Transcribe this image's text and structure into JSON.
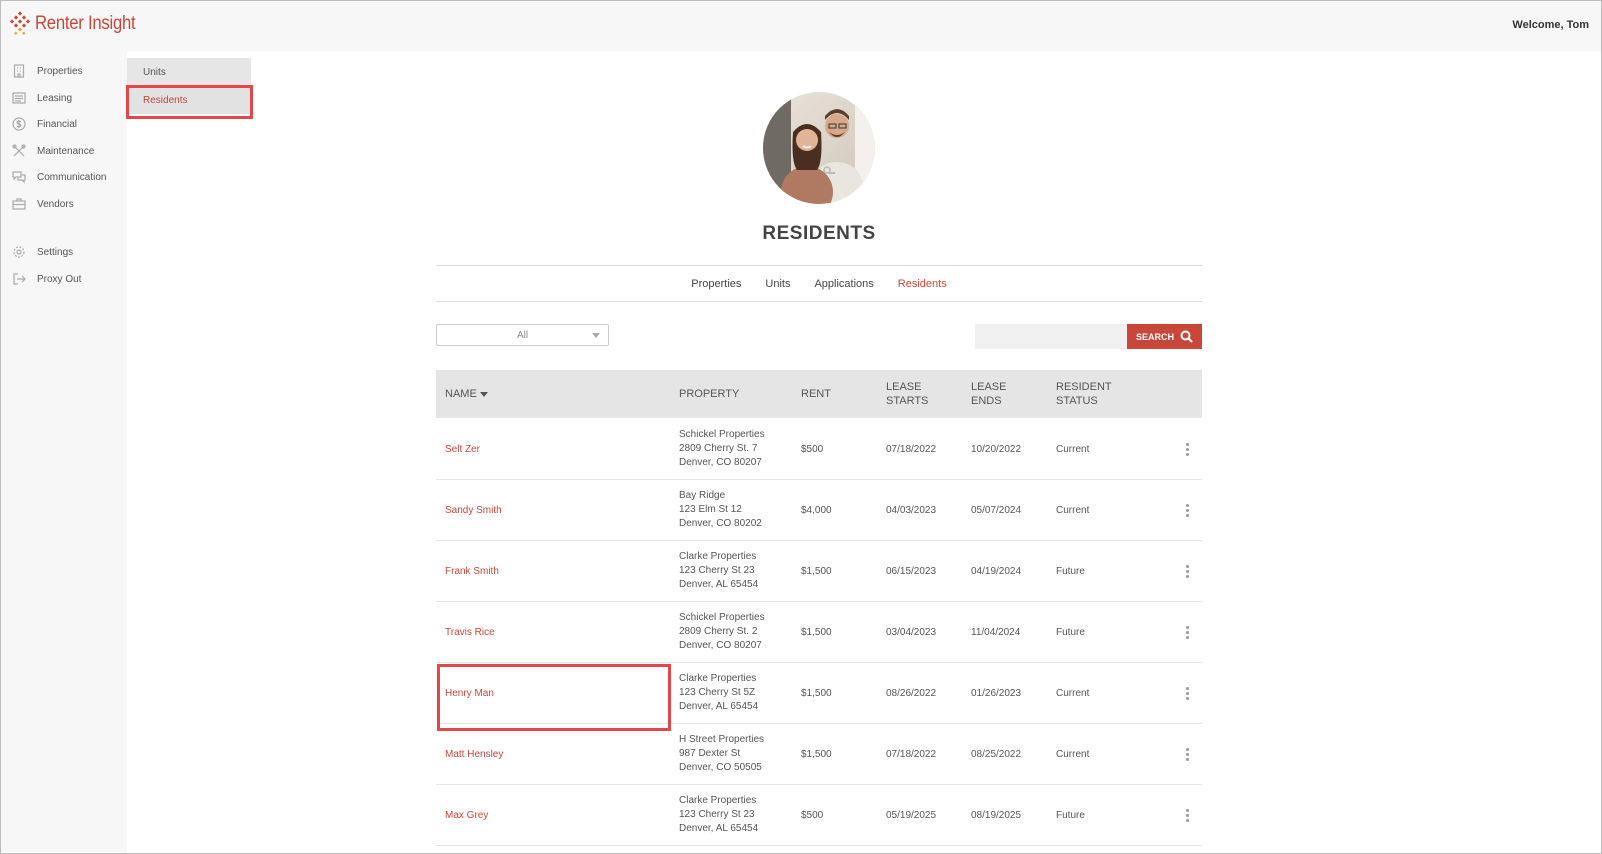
{
  "app": {
    "logo_text": "Renter Insight",
    "welcome": "Welcome, Tom"
  },
  "sidebar": {
    "items": [
      {
        "label": "Properties",
        "icon": "building-icon"
      },
      {
        "label": "Leasing",
        "icon": "list-icon"
      },
      {
        "label": "Financial",
        "icon": "dollar-icon"
      },
      {
        "label": "Maintenance",
        "icon": "tools-icon"
      },
      {
        "label": "Communication",
        "icon": "chat-icon"
      },
      {
        "label": "Vendors",
        "icon": "briefcase-icon"
      },
      {
        "label": "Settings",
        "icon": "gear-icon"
      },
      {
        "label": "Proxy Out",
        "icon": "exit-icon"
      }
    ]
  },
  "submenu": {
    "items": [
      {
        "label": "Units"
      },
      {
        "label": "Residents"
      }
    ],
    "active": "Residents"
  },
  "main": {
    "title": "RESIDENTS",
    "tabs": [
      {
        "label": "Properties"
      },
      {
        "label": "Units"
      },
      {
        "label": "Applications"
      },
      {
        "label": "Residents"
      }
    ],
    "active_tab": "Residents",
    "filter": {
      "value": "All"
    },
    "search": {
      "value": "",
      "button_label": "SEARCH"
    }
  },
  "table": {
    "columns": [
      {
        "label": "NAME"
      },
      {
        "label": "PROPERTY"
      },
      {
        "label": "RENT"
      },
      {
        "label": "LEASE\nSTARTS"
      },
      {
        "label": "LEASE\nENDS"
      },
      {
        "label": "RESIDENT\nSTATUS"
      }
    ],
    "rows": [
      {
        "name": "Selt Zer",
        "property": "Schickel Properties",
        "address1": "2809 Cherry St. 7",
        "address2": "Denver, CO 80207",
        "rent": "$500",
        "lease_start": "07/18/2022",
        "lease_end": "10/20/2022",
        "status": "Current"
      },
      {
        "name": "Sandy Smith",
        "property": "Bay Ridge",
        "address1": "123 Elm St 12",
        "address2": "Denver, CO 80202",
        "rent": "$4,000",
        "lease_start": "04/03/2023",
        "lease_end": "05/07/2024",
        "status": "Current"
      },
      {
        "name": "Frank Smith",
        "property": "Clarke Properties",
        "address1": "123 Cherry St 23",
        "address2": "Denver, AL 65454",
        "rent": "$1,500",
        "lease_start": "06/15/2023",
        "lease_end": "04/19/2024",
        "status": "Future"
      },
      {
        "name": "Travis Rice",
        "property": "Schickel Properties",
        "address1": "2809 Cherry St. 2",
        "address2": "Denver, CO 80207",
        "rent": "$1,500",
        "lease_start": "03/04/2023",
        "lease_end": "11/04/2024",
        "status": "Future"
      },
      {
        "name": "Henry Man",
        "property": "Clarke Properties",
        "address1": "123 Cherry St 5Z",
        "address2": "Denver, AL 65454",
        "rent": "$1,500",
        "lease_start": "08/26/2022",
        "lease_end": "01/26/2023",
        "status": "Current"
      },
      {
        "name": "Matt Hensley",
        "property": "H Street Properties",
        "address1": "987 Dexter St",
        "address2": "Denver, CO 50505",
        "rent": "$1,500",
        "lease_start": "07/18/2022",
        "lease_end": "08/25/2022",
        "status": "Current"
      },
      {
        "name": "Max Grey",
        "property": "Clarke Properties",
        "address1": "123 Cherry St 23",
        "address2": "Denver, AL 65454",
        "rent": "$500",
        "lease_start": "05/19/2025",
        "lease_end": "08/19/2025",
        "status": "Future"
      }
    ]
  },
  "colors": {
    "accent": "#c8473a",
    "highlight": "#e0484a",
    "sidebar_bg": "#f7f7f7",
    "header_bg": "#e5e5e5"
  }
}
